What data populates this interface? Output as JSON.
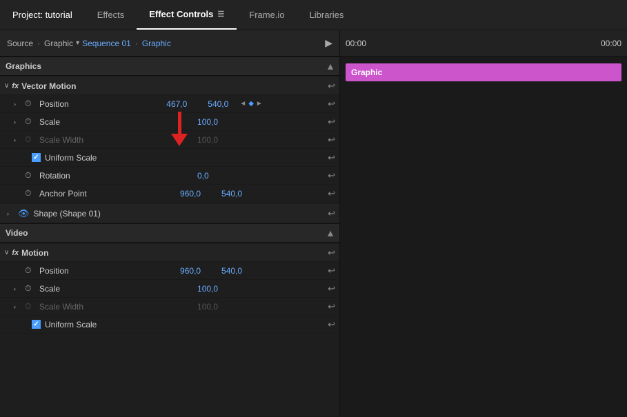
{
  "tabs": [
    {
      "label": "Project: tutorial",
      "active": false
    },
    {
      "label": "Effects",
      "active": false
    },
    {
      "label": "Effect Controls",
      "active": true
    },
    {
      "label": "Frame.io",
      "active": false
    },
    {
      "label": "Libraries",
      "active": false
    }
  ],
  "source": {
    "label": "Source",
    "separator": "·",
    "graphic": "Graphic",
    "sequence": "Sequence 01",
    "sequence_graphic": "Graphic"
  },
  "sections": {
    "graphics": {
      "title": "Graphics",
      "effects": [
        {
          "name": "Vector Motion",
          "properties": [
            {
              "name": "Position",
              "value1": "467,0",
              "value2": "540,0",
              "hasKeyframe": true,
              "hasNavArrows": true,
              "icon": "timer"
            },
            {
              "name": "Scale",
              "value1": "100,0",
              "value2": null,
              "icon": "timer"
            },
            {
              "name": "Scale Width",
              "value1": "100,0",
              "value2": null,
              "icon": "timer",
              "disabled": true
            },
            {
              "name": "Uniform Scale",
              "type": "checkbox",
              "checked": true
            },
            {
              "name": "Rotation",
              "value1": "0,0",
              "value2": null,
              "icon": "timer"
            },
            {
              "name": "Anchor Point",
              "value1": "960,0",
              "value2": "540,0",
              "icon": "timer"
            }
          ]
        }
      ],
      "shape": "Shape (Shape 01)"
    },
    "video": {
      "title": "Video",
      "effects": [
        {
          "name": "Motion",
          "properties": [
            {
              "name": "Position",
              "value1": "960,0",
              "value2": "540,0",
              "icon": "timer"
            },
            {
              "name": "Scale",
              "value1": "100,0",
              "value2": null,
              "icon": "timer"
            },
            {
              "name": "Scale Width",
              "value1": "100,0",
              "value2": null,
              "icon": "timer",
              "disabled": true
            },
            {
              "name": "Uniform Scale",
              "type": "checkbox",
              "checked": true
            }
          ]
        }
      ]
    }
  },
  "timeline": {
    "time_start": "00:00",
    "time_end": "00:00",
    "clip_label": "Graphic"
  },
  "icons": {
    "timer": "⏱",
    "reset": "↩",
    "eye": "👁",
    "play": "▶",
    "chevron_down": "▾",
    "chevron_right": "›",
    "arrow_left": "◄",
    "arrow_right": "►",
    "diamond": "◆",
    "check": "✓",
    "scroll_up": "▲"
  }
}
